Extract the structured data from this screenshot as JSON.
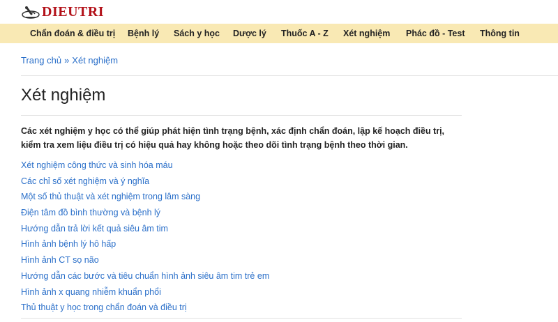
{
  "site": {
    "logo_text": "DIEUTRI",
    "logo_icon": "microscope-icon"
  },
  "nav": [
    {
      "label": "Chẩn đoán & điều trị"
    },
    {
      "label": "Bệnh lý"
    },
    {
      "label": "Sách y học"
    },
    {
      "label": "Dược lý"
    },
    {
      "label": "Thuốc A - Z"
    },
    {
      "label": "Xét nghiệm"
    },
    {
      "label": "Phác đồ - Test"
    },
    {
      "label": "Thông tin"
    }
  ],
  "breadcrumb": {
    "home": "Trang chủ",
    "separator": "»",
    "current": "Xét nghiệm"
  },
  "page": {
    "title": "Xét nghiệm",
    "intro": "Các xét nghiệm y học có thể giúp phát hiện tình trạng bệnh, xác định chẩn đoán, lập kế hoạch điều trị, kiểm tra xem liệu điều trị có hiệu quả hay không hoặc theo dõi tình trạng bệnh theo thời gian."
  },
  "links": [
    {
      "label": "Xét nghiệm công thức và sinh hóa máu"
    },
    {
      "label": "Các chỉ số xét nghiệm và ý nghĩa"
    },
    {
      "label": "Một số thủ thuật và xét nghiệm trong lâm sàng"
    },
    {
      "label": "Điện tâm đồ bình thường và bệnh lý"
    },
    {
      "label": "Hướng dẫn trả lời kết quả siêu âm tim"
    },
    {
      "label": "Hình ảnh bệnh lý hô hấp"
    },
    {
      "label": "Hình ảnh CT sọ não"
    },
    {
      "label": "Hướng dẫn các bước và tiêu chuẩn hình ảnh siêu âm tim trẻ em"
    },
    {
      "label": "Hình ảnh x quang nhiễm khuẩn phổi"
    },
    {
      "label": "Thủ thuật y học trong chẩn đoán và điều trị"
    }
  ],
  "colors": {
    "brand": "#b3121a",
    "nav_bg": "#f9e9b4",
    "link": "#2a6fc9"
  }
}
